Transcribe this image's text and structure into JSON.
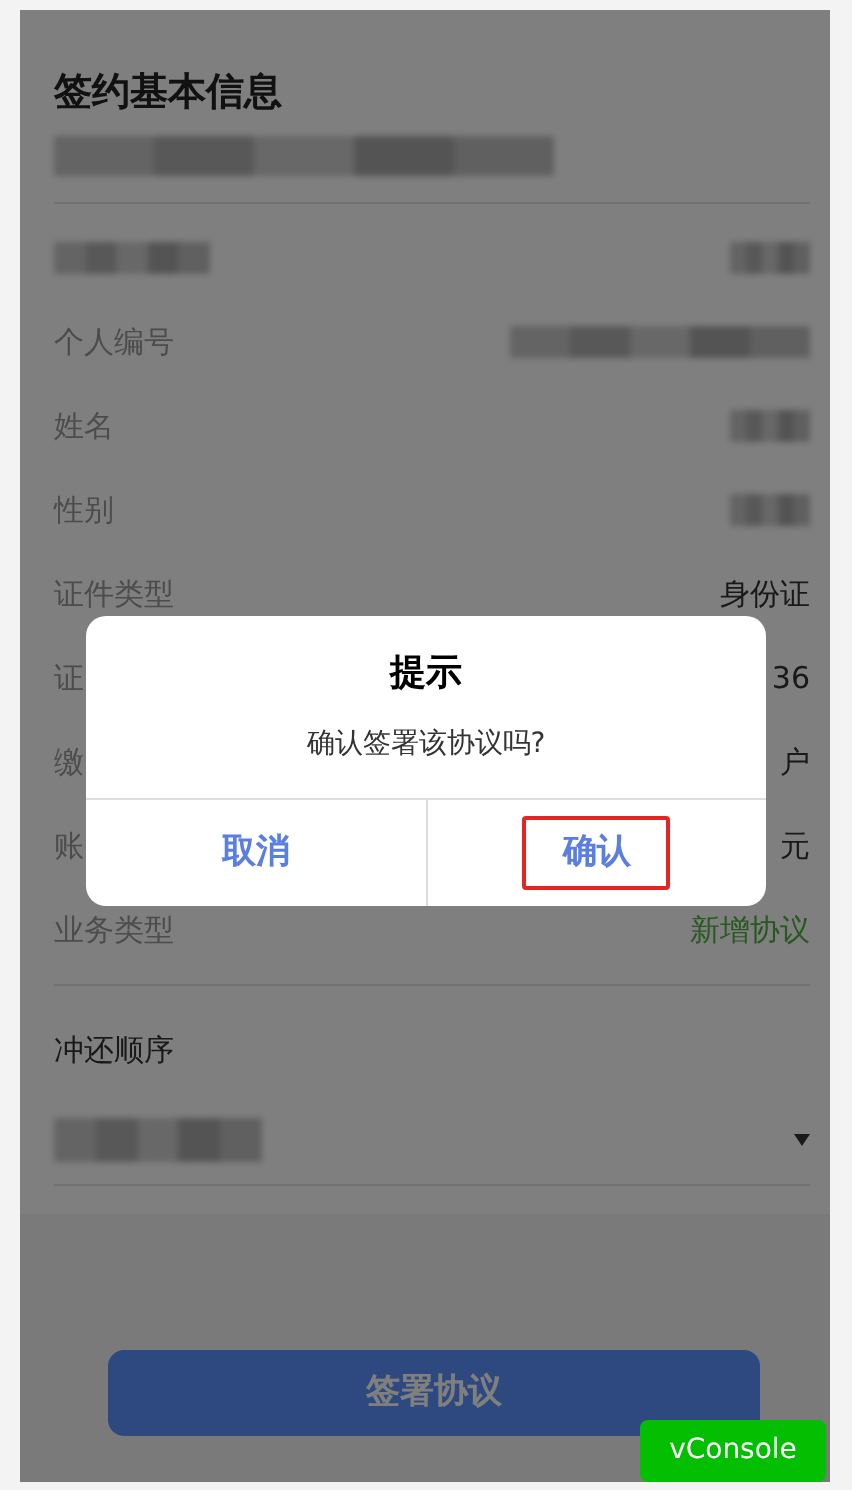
{
  "page": {
    "title": "签约基本信息",
    "subtitle_redacted": true
  },
  "rows": [
    {
      "label_redacted": true,
      "value_redacted": true
    },
    {
      "label": "个人编号",
      "value_redacted": true
    },
    {
      "label": "姓名",
      "value_redacted": true
    },
    {
      "label": "性别",
      "value_redacted": true
    },
    {
      "label": "证件类型",
      "value": "身份证"
    },
    {
      "label": "证",
      "value": "36"
    },
    {
      "label": "缴",
      "value": "户"
    },
    {
      "label": "账",
      "value": "元"
    },
    {
      "label": "业务类型",
      "value": "新增协议",
      "kind": "status"
    }
  ],
  "repay_order": {
    "label": "冲还顺序",
    "value_redacted": true
  },
  "submit_button": {
    "label": "签署协议"
  },
  "dialog": {
    "title": "提示",
    "message": "确认签署该协议吗?",
    "buttons": [
      {
        "label": "取消",
        "highlighted": false
      },
      {
        "label": "确认",
        "highlighted": true
      }
    ]
  },
  "debug_button": {
    "label": "vConsole"
  }
}
